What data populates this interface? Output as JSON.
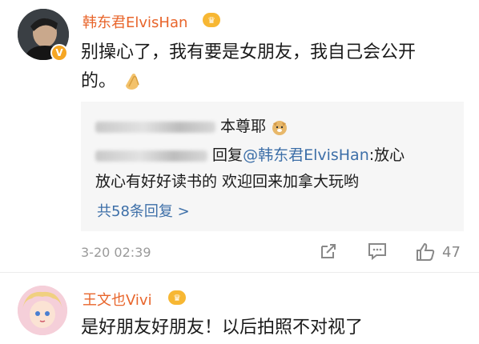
{
  "post": {
    "username": "韩东君ElvisHan",
    "verified_badge": "V",
    "crown_label": "♛",
    "text_line1": "别操心了，我有要是女朋友，我自己会公开",
    "text_line2": "的。",
    "emoji": "clapping-hands-emoji",
    "time": "3-20 02:39",
    "like_count": "47",
    "replies": {
      "reply1_text": "本尊耶",
      "reply2_prefix": "回复",
      "reply2_mention": "@韩东君ElvisHan",
      "reply2_rest": ":放心",
      "reply2_line2": "放心有好好读书的 欢迎回来加拿大玩哟",
      "more_label": "共58条回复 >"
    }
  },
  "comment2": {
    "username": "王文也Vivi",
    "crown_label": "♛",
    "text": "是好朋友好朋友！以后拍照不对视了"
  },
  "colors": {
    "username": "#e8652b",
    "link": "#3d6fa8",
    "panel_bg": "#f6f6f6"
  }
}
